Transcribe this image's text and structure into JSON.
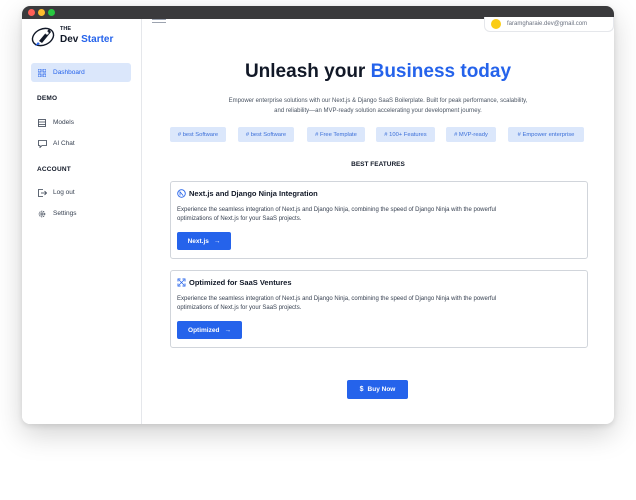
{
  "brand": {
    "the": "THE",
    "name_prefix": "Dev",
    "name_accent": "Starter"
  },
  "sidebar": {
    "items": [
      {
        "label": "Dashboard",
        "icon": "dashboard-grid-icon",
        "active": true
      },
      {
        "label": "Models",
        "icon": "models-icon"
      },
      {
        "label": "AI Chat",
        "icon": "chat-icon"
      },
      {
        "label": "Log out",
        "icon": "logout-icon"
      },
      {
        "label": "Settings",
        "icon": "gear-icon"
      }
    ],
    "sections": {
      "demo": "DEMO",
      "account": "ACCOUNT"
    }
  },
  "user": {
    "email": "faramgharaie.dev@gmail.com"
  },
  "hero": {
    "title_prefix": "Unleash your ",
    "title_accent": "Business today",
    "subtitle_line1": "Empower enterprise solutions with our Next.js & Django SaaS Boilerplate. Built for peak performance, scalability,",
    "subtitle_line2": "and reliability—an MVP-ready solution accelerating your development journey."
  },
  "tags": [
    "# best Software",
    "# best Software",
    "# Free Template",
    "# 100+ Features",
    "# MVP-ready",
    "# Empower enterprise"
  ],
  "features_heading": "BEST FEATURES",
  "cards": [
    {
      "title": "Next.js and Django Ninja Integration",
      "icon": "nextjs-icon",
      "desc_line1": "Experience the seamless integration of Next.js and Django Ninja, combining the speed of Django Ninja with the powerful",
      "desc_line2": "optimizations of Next.js for your SaaS projects.",
      "button": "Next.js"
    },
    {
      "title": "Optimized for SaaS Ventures",
      "icon": "expand-icon",
      "desc_line1": "Experience the seamless integration of Next.js and Django Ninja, combining the speed of Django Ninja with the powerful",
      "desc_line2": "optimizations of Next.js for your SaaS projects.",
      "button": "Optimized"
    }
  ],
  "buy_button": "Buy Now",
  "colors": {
    "accent": "#2563eb",
    "tag_bg": "#dbe7fb",
    "active_nav_bg": "#dbe7fb"
  }
}
